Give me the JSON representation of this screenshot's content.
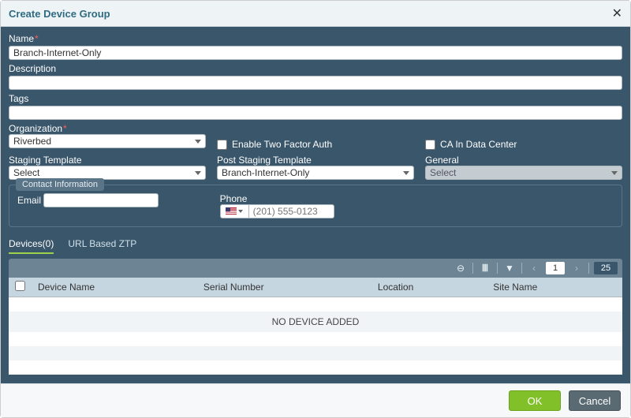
{
  "titlebar": {
    "title": "Create Device Group"
  },
  "fields": {
    "name": {
      "label": "Name",
      "value": "Branch-Internet-Only"
    },
    "description": {
      "label": "Description",
      "value": ""
    },
    "tags": {
      "label": "Tags",
      "value": ""
    },
    "organization": {
      "label": "Organization",
      "value": "Riverbed"
    },
    "enable_2fa": {
      "label": "Enable Two Factor Auth"
    },
    "ca_datacenter": {
      "label": "CA In Data Center"
    },
    "staging_template": {
      "label": "Staging Template",
      "value": "Select"
    },
    "post_staging_template": {
      "label": "Post Staging Template",
      "value": "Branch-Internet-Only"
    },
    "general": {
      "label": "General",
      "value": "Select"
    }
  },
  "contact": {
    "heading": "Contact Information",
    "email": {
      "label": "Email",
      "value": ""
    },
    "phone": {
      "label": "Phone",
      "placeholder": "(201) 555-0123"
    }
  },
  "tabs": {
    "devices": {
      "label": "Devices(0)"
    },
    "ztp": {
      "label": "URL Based ZTP"
    }
  },
  "table": {
    "columns": {
      "c1": "Device Name",
      "c2": "Serial Number",
      "c3": "Location",
      "c4": "Site Name"
    },
    "empty": "NO DEVICE ADDED",
    "page": "1",
    "page_size": "25"
  },
  "footer": {
    "ok": "OK",
    "cancel": "Cancel"
  }
}
